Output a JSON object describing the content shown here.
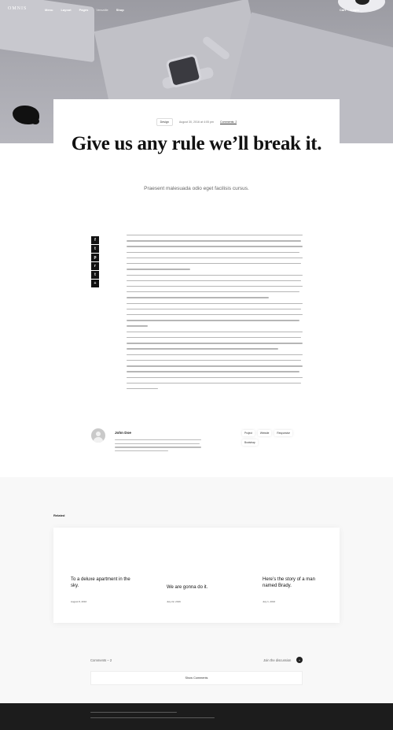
{
  "nav": {
    "logo": "OMNIS",
    "links": [
      "Menu",
      "Layout",
      "Pages",
      "Versatile",
      "Shop"
    ],
    "right": [
      "Cart",
      "Login"
    ]
  },
  "article": {
    "category": "Design",
    "date": "August 30, 2016 at 4:05 pm",
    "comments": "Comments: 2",
    "title": "Give us any rule we’ll break it.",
    "subtitle": "Praesent malesuada odio eget facilisis cursus."
  },
  "share": {
    "icons": [
      "facebook-icon",
      "twitter-icon",
      "pinterest-icon",
      "reddit-icon",
      "tumblr-icon",
      "share-icon"
    ]
  },
  "author": {
    "name": "John Doe",
    "tags": [
      "Project",
      "Website",
      "Responsive",
      "Bootstrap"
    ]
  },
  "related": {
    "label": "Related",
    "items": [
      {
        "title": "To a deluxe apartment in the sky.",
        "date": "August 8, 2016"
      },
      {
        "title": "We are gonna do it.",
        "date": "July 22, 2016"
      },
      {
        "title": "Here’s the story of a man named Brady.",
        "date": "July 1, 2016"
      }
    ]
  },
  "comments": {
    "count": "Comments – 2",
    "join": "Join the discussion",
    "badge": "+",
    "button": "Show Comments"
  },
  "colors": {
    "footer": "#1c1c1c",
    "accent": "#111111"
  }
}
